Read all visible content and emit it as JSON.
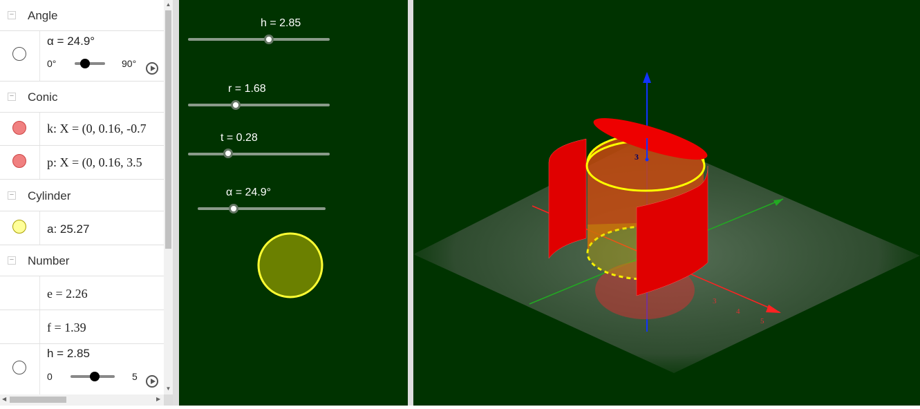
{
  "algebra": {
    "groups": {
      "angle": "Angle",
      "conic": "Conic",
      "cylinder": "Cylinder",
      "number": "Number"
    },
    "alpha": {
      "def": "α = 24.9°",
      "min": "0°",
      "max": "90°",
      "level": 0.277
    },
    "k": {
      "def": "k: X = (0, 0.16, -0.7"
    },
    "p": {
      "def": "p: X = (0, 0.16, 3.5"
    },
    "a": {
      "def": "a: 25.27"
    },
    "e": {
      "def": "e = 2.26"
    },
    "f": {
      "def": "f = 1.39"
    },
    "h": {
      "def": "h = 2.85",
      "min": "0",
      "max": "5",
      "level": 0.57
    }
  },
  "graphics2d": {
    "sliders": {
      "h": "h = 2.85",
      "r": "r = 1.68",
      "t": "t = 0.28",
      "alpha": "α = 24.9°"
    }
  },
  "graphics3d": {
    "z_tick": "3",
    "x_ticks": [
      "3",
      "4",
      "5"
    ],
    "colors": {
      "background": "#003300",
      "cylinder": "#dd0000",
      "circle": "#ffff00",
      "x_axis": "#ff2222",
      "y_axis": "#22aa22",
      "z_axis": "#1122ff"
    }
  }
}
